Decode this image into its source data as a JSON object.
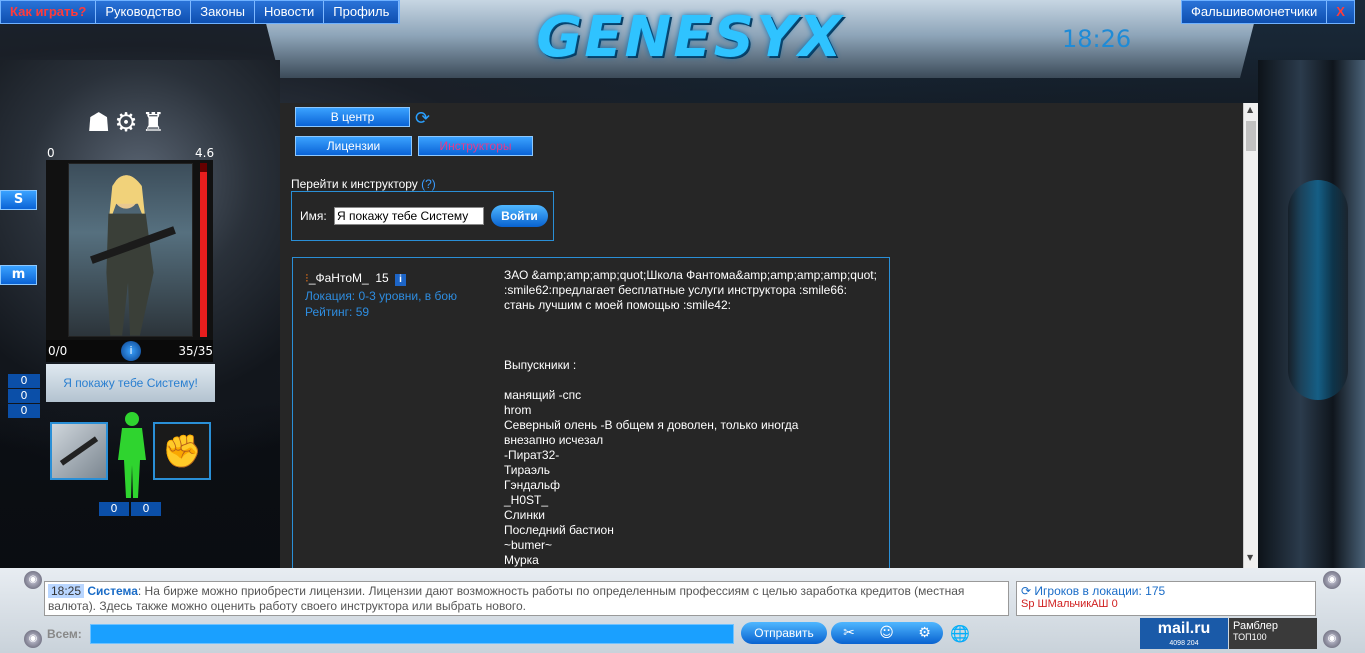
{
  "topbar": {
    "items": [
      "Как играть?",
      "Руководство",
      "Законы",
      "Новости",
      "Профиль"
    ],
    "right_link": "Фальшивомонетчики",
    "close": "X"
  },
  "logo": "GENESYX",
  "clock": "18:26",
  "nav": {
    "center_button": "В центр",
    "licenses_button": "Лицензии",
    "instructors_button": "Инструкторы"
  },
  "goto": {
    "label": "Перейти к инструктору",
    "hint": "(?)",
    "name_label": "Имя:",
    "name_value": "Я покажу тебе Систему",
    "go_button": "Войти"
  },
  "instructor": {
    "name": "_ФаНтоМ_",
    "level": "15",
    "info": "i",
    "location": "Локация: 0-3 уровни, в бою",
    "rating": "Рейтинг: 59",
    "description": "ЗАО &amp;amp;amp;quot;Школа Фантома&amp;amp;amp;amp;quot; :smile62:предлагает бесплатные услуги инструктора :smile66: стань лучшим с моей помощью :smile42:",
    "graduates_title": "Выпускники :",
    "graduates": [
      "манящий -спс",
      "hrom",
      "Северный олень -В общем я доволен, только иногда",
      "внезапно исчезал",
      "-Пират32-",
      "Тираэль",
      "Гэндальф",
      "_H0ST_",
      "Слинки",
      "Последний бастион",
      "~bumer~",
      "Мурка"
    ]
  },
  "character": {
    "level_left": "0",
    "level_right": "4.6",
    "hp_fraction": 0.95,
    "stat_left": "0/0",
    "stat_mid": "i",
    "stat_right": "35/35",
    "name": "Я покажу тебе Систему!",
    "counters": [
      "0",
      "0",
      "0"
    ],
    "bottom_counters": [
      "0",
      "0"
    ],
    "side_buttons": [
      "S",
      "m"
    ]
  },
  "chat": {
    "time": "18:25",
    "sender": "Система",
    "message": ": На бирже можно приобрести лицензии. Лицензии дают возможность работы по определенным профессиям с целью заработка кредитов (местная валюта). Здесь также можно оценить работу своего инструктора или выбрать нового.",
    "input_label": "Всем:",
    "send_button": "Отправить"
  },
  "players": {
    "label": "Игроков в локации: 175",
    "partial": "Sp  ШМальчикАШ  0"
  },
  "ads": {
    "mailru": "mail.ru",
    "mailru_sub": "4098    204",
    "rambler": "Рамблер",
    "rambler_sub": "ТОП100"
  }
}
